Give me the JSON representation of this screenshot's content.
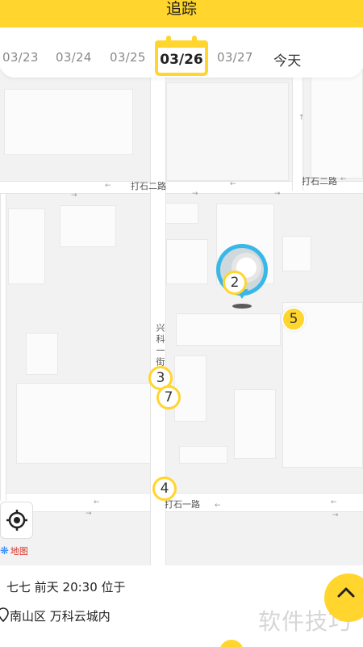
{
  "header": {
    "title": "追踪"
  },
  "dates": {
    "items": [
      "03/23",
      "03/24",
      "03/25",
      "03/26",
      "03/27"
    ],
    "selected": "03/26",
    "today_label": "今天"
  },
  "map": {
    "roads": {
      "upper": "打石二路",
      "upper_right": "打石二路",
      "lower": "打石一路",
      "vertical": "兴科一街"
    },
    "markers": [
      "2",
      "3",
      "7",
      "4",
      "5"
    ],
    "logo_text": "地图"
  },
  "info": {
    "line1": "七七 前天 20:30 位于",
    "line2": "南山区 万科云城内",
    "watermark": "软件技巧"
  },
  "icons": {
    "locate": "locate-target-icon",
    "expand": "chevron-up-icon",
    "location": "location-pin-icon",
    "avatar": "pet-avatar-icon"
  },
  "colors": {
    "accent": "#FFD52E",
    "pin": "#39B8E8"
  }
}
